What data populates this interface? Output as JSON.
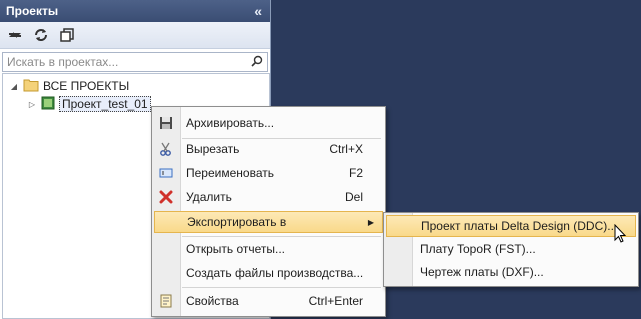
{
  "panel": {
    "title": "Проекты",
    "collapse_icon": "double-chevron-left-icon",
    "toolbar": [
      "sync-icon",
      "refresh-icon",
      "copy-icon"
    ],
    "search": {
      "placeholder": "Искать в проектах..."
    }
  },
  "tree": {
    "root": {
      "label": "ВСЕ ПРОЕКТЫ",
      "expanded": true
    },
    "children": [
      {
        "label": "Проект_test_01"
      }
    ]
  },
  "context_menu": {
    "items": [
      {
        "label": "Архивировать...",
        "shortcut": "",
        "icon": "save-icon"
      },
      {
        "label": "Вырезать",
        "shortcut": "Ctrl+X",
        "icon": "scissors-icon"
      },
      {
        "label": "Переименовать",
        "shortcut": "F2",
        "icon": "rename-icon"
      },
      {
        "label": "Удалить",
        "shortcut": "Del",
        "icon": "delete-icon"
      },
      {
        "label": "Экспортировать в",
        "shortcut": "",
        "icon": ""
      },
      {
        "label": "Открыть отчеты...",
        "shortcut": "",
        "icon": ""
      },
      {
        "label": "Создать файлы производства...",
        "shortcut": "",
        "icon": ""
      },
      {
        "label": "Свойства",
        "shortcut": "Ctrl+Enter",
        "icon": "properties-icon"
      }
    ]
  },
  "submenu": {
    "items": [
      {
        "label": "Проект платы Delta Design (DDC)..."
      },
      {
        "label": "Плату TopoR (FST)..."
      },
      {
        "label": "Чертеж платы (DXF)..."
      }
    ]
  },
  "colors": {
    "background": "#2b3a5c",
    "highlight": "#f9d98a",
    "header": "#3a4d73"
  }
}
